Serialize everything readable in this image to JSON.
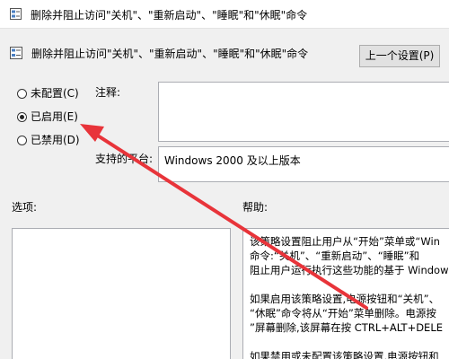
{
  "window": {
    "title": "删除并阻止访问\"关机\"、\"重新启动\"、\"睡眠\"和\"休眠\"命令"
  },
  "header": {
    "title": "删除并阻止访问\"关机\"、\"重新启动\"、\"睡眠\"和\"休眠\"命令",
    "prev_button": "上一个设置(P)"
  },
  "radios": [
    {
      "label": "未配置(C)",
      "checked": false
    },
    {
      "label": "已启用(E)",
      "checked": true
    },
    {
      "label": "已禁用(D)",
      "checked": false
    }
  ],
  "comment": {
    "label": "注释:"
  },
  "platform": {
    "label": "支持的平台:",
    "value": "Windows 2000 及以上版本"
  },
  "options": {
    "label": "选项:"
  },
  "help": {
    "label": "帮助:",
    "lines": [
      "该策略设置阻止用户从“开始”菜单或“Win",
      "命令:“关机”、“重新启动”、“睡眠”和",
      "阻止用户运行执行这些功能的基于 Windows",
      "",
      "如果启用该策略设置,电源按钮和“关机”、",
      "“休眠”命令将从“开始”菜单删除。电源按",
      "”屏幕删除,该屏幕在按 CTRL+ALT+DELE",
      "",
      "如果禁用或未配置该策略设置,电源按钮和"
    ]
  },
  "colors": {
    "arrow": "#e8343a",
    "window_bg": "#f0f0f0"
  }
}
